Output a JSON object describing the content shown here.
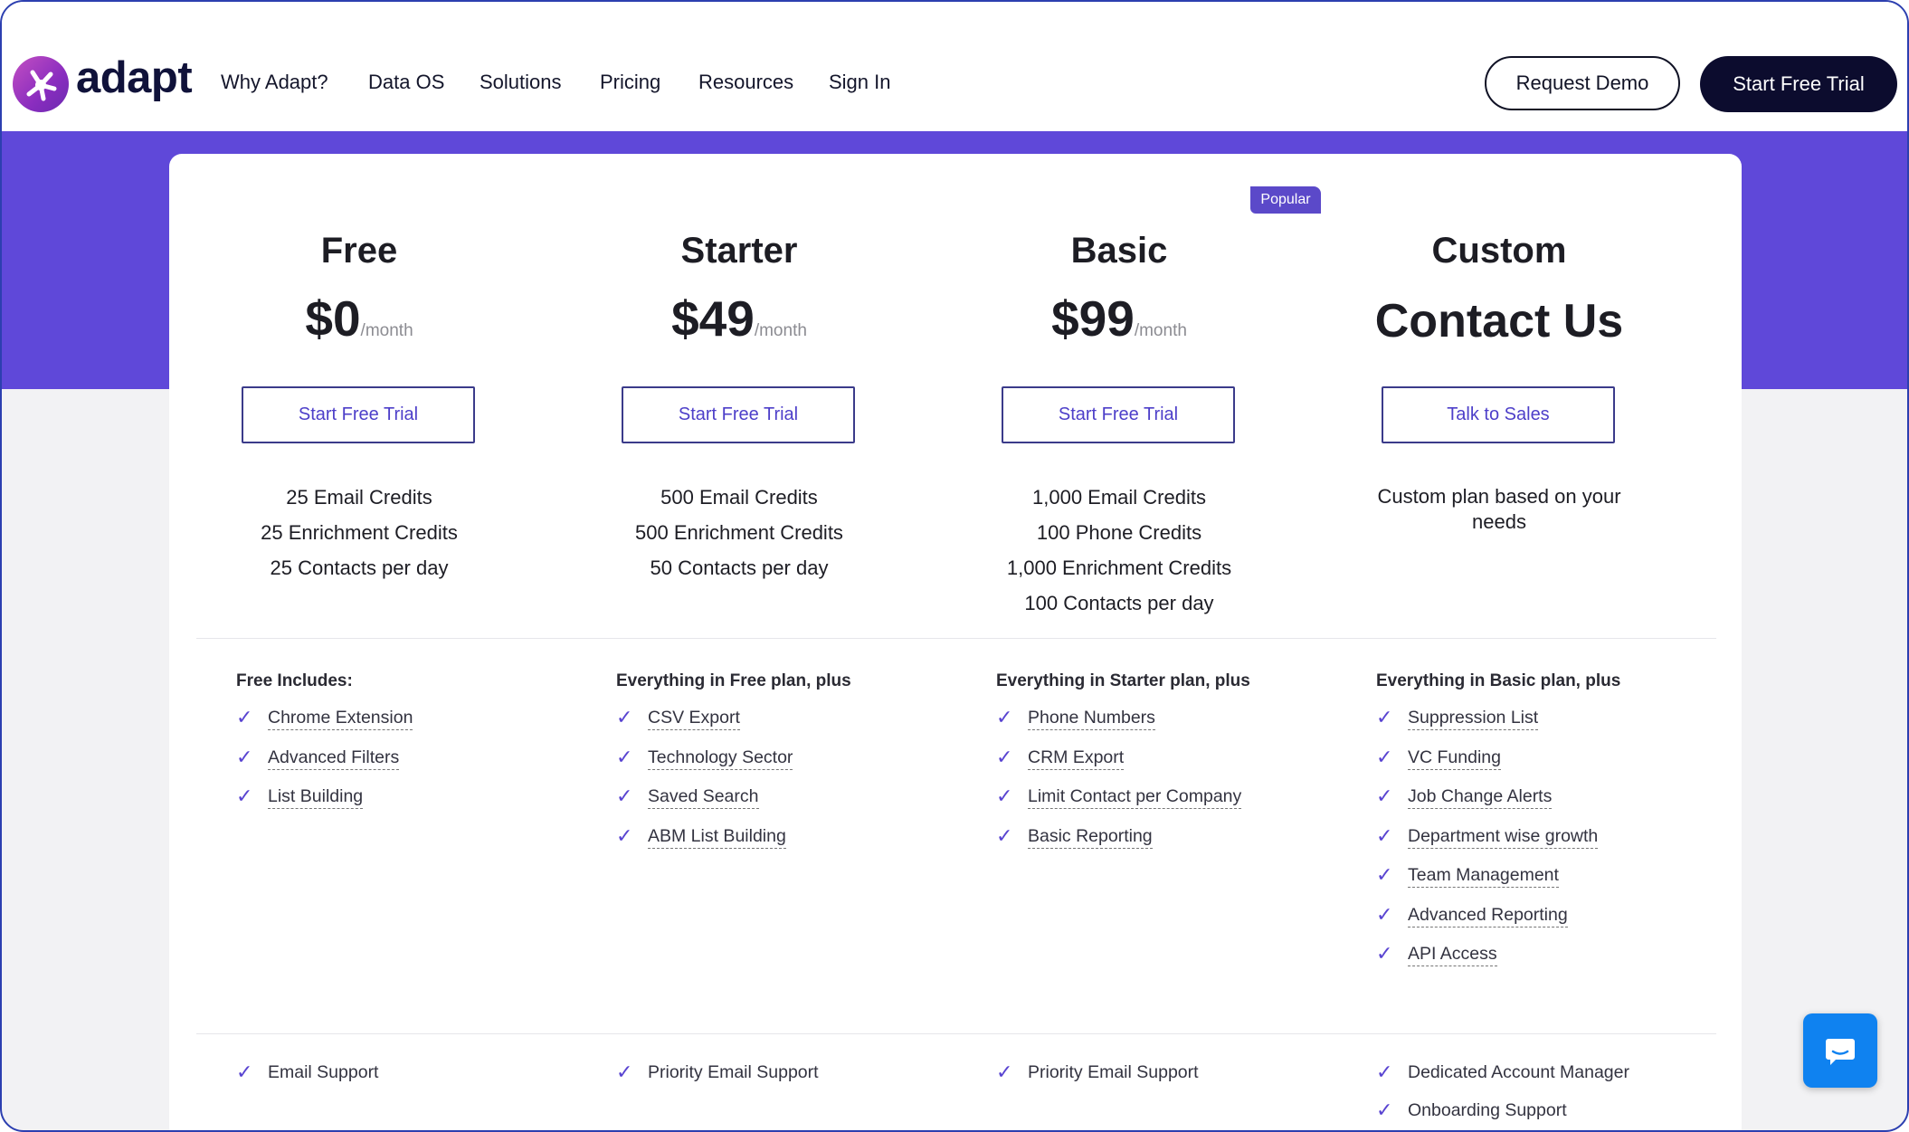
{
  "brand": {
    "name": "adapt",
    "logo_icon": "adapt-starburst-logo",
    "accent": "#5f48d9",
    "dark": "#0c0c2e"
  },
  "nav": {
    "items": [
      "Why Adapt?",
      "Data OS",
      "Solutions",
      "Pricing",
      "Resources",
      "Sign In"
    ],
    "request_demo": "Request Demo",
    "start_trial": "Start Free Trial"
  },
  "popular_badge": "Popular",
  "plans": [
    {
      "name": "Free",
      "price": "$0",
      "per": "/month",
      "cta": "Start Free Trial",
      "credits": [
        "25 Email Credits",
        "25 Enrichment Credits",
        "25 Contacts per day"
      ],
      "features_title": "Free Includes:",
      "features": [
        "Chrome Extension",
        "Advanced Filters",
        "List Building"
      ],
      "support": [
        "Email Support"
      ]
    },
    {
      "name": "Starter",
      "price": "$49",
      "per": "/month",
      "cta": "Start Free Trial",
      "credits": [
        "500 Email Credits",
        "500 Enrichment Credits",
        "50 Contacts per day"
      ],
      "features_title": "Everything in Free plan, plus",
      "features": [
        "CSV Export",
        "Technology Sector",
        "Saved Search",
        "ABM List Building"
      ],
      "support": [
        "Priority Email Support"
      ]
    },
    {
      "name": "Basic",
      "price": "$99",
      "per": "/month",
      "cta": "Start Free Trial",
      "credits": [
        "1,000 Email Credits",
        "100 Phone Credits",
        "1,000 Enrichment Credits",
        "100 Contacts per day"
      ],
      "features_title": "Everything in Starter plan, plus",
      "features": [
        "Phone Numbers",
        "CRM Export",
        "Limit Contact per Company",
        "Basic Reporting"
      ],
      "support": [
        "Priority Email Support"
      ]
    },
    {
      "name": "Custom",
      "price": "Contact Us",
      "cta": "Talk to Sales",
      "description": "Custom plan based on your needs",
      "features_title": "Everything in Basic plan, plus",
      "features": [
        "Suppression List",
        "VC Funding",
        "Job Change Alerts",
        "Department wise growth",
        "Team Management",
        "Advanced Reporting",
        "API Access"
      ],
      "support": [
        "Dedicated Account Manager",
        "Onboarding Support"
      ]
    }
  ],
  "chat_widget": {
    "icon": "chat-bubble-icon",
    "color": "#0f82f0"
  }
}
